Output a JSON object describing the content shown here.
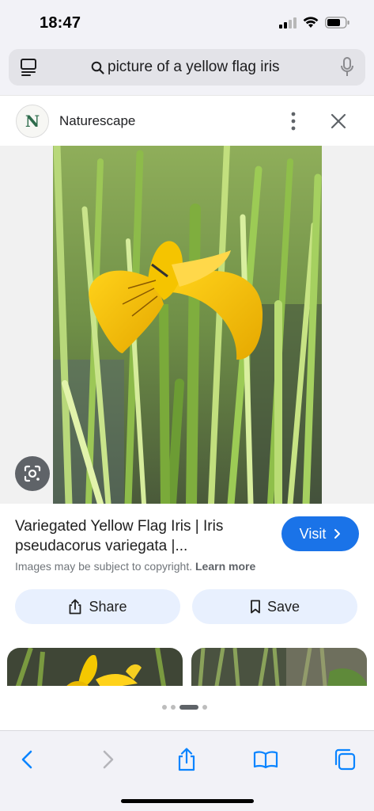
{
  "status_bar": {
    "time": "18:47"
  },
  "search": {
    "query": "picture of a yellow flag iris"
  },
  "source": {
    "logo_letter": "N",
    "name": "Naturescape"
  },
  "result": {
    "title": "Variegated Yellow Flag Iris | Iris pseudacorus variegata |...",
    "visit_label": "Visit",
    "copyright_text": "Images may be subject to copyright.",
    "learn_more": "Learn more",
    "share_label": "Share",
    "save_label": "Save"
  },
  "pager": {
    "active_index": 2,
    "total": 4
  },
  "colors": {
    "accent": "#1a73e8",
    "action_bg": "#e8f0fe",
    "toolbar_blue": "#0a84ff"
  },
  "icons": {
    "status": [
      "cellular-icon",
      "wifi-icon",
      "battery-icon"
    ],
    "toolbar": [
      "back-icon",
      "forward-icon",
      "share-icon",
      "bookmarks-icon",
      "tabs-icon"
    ]
  }
}
